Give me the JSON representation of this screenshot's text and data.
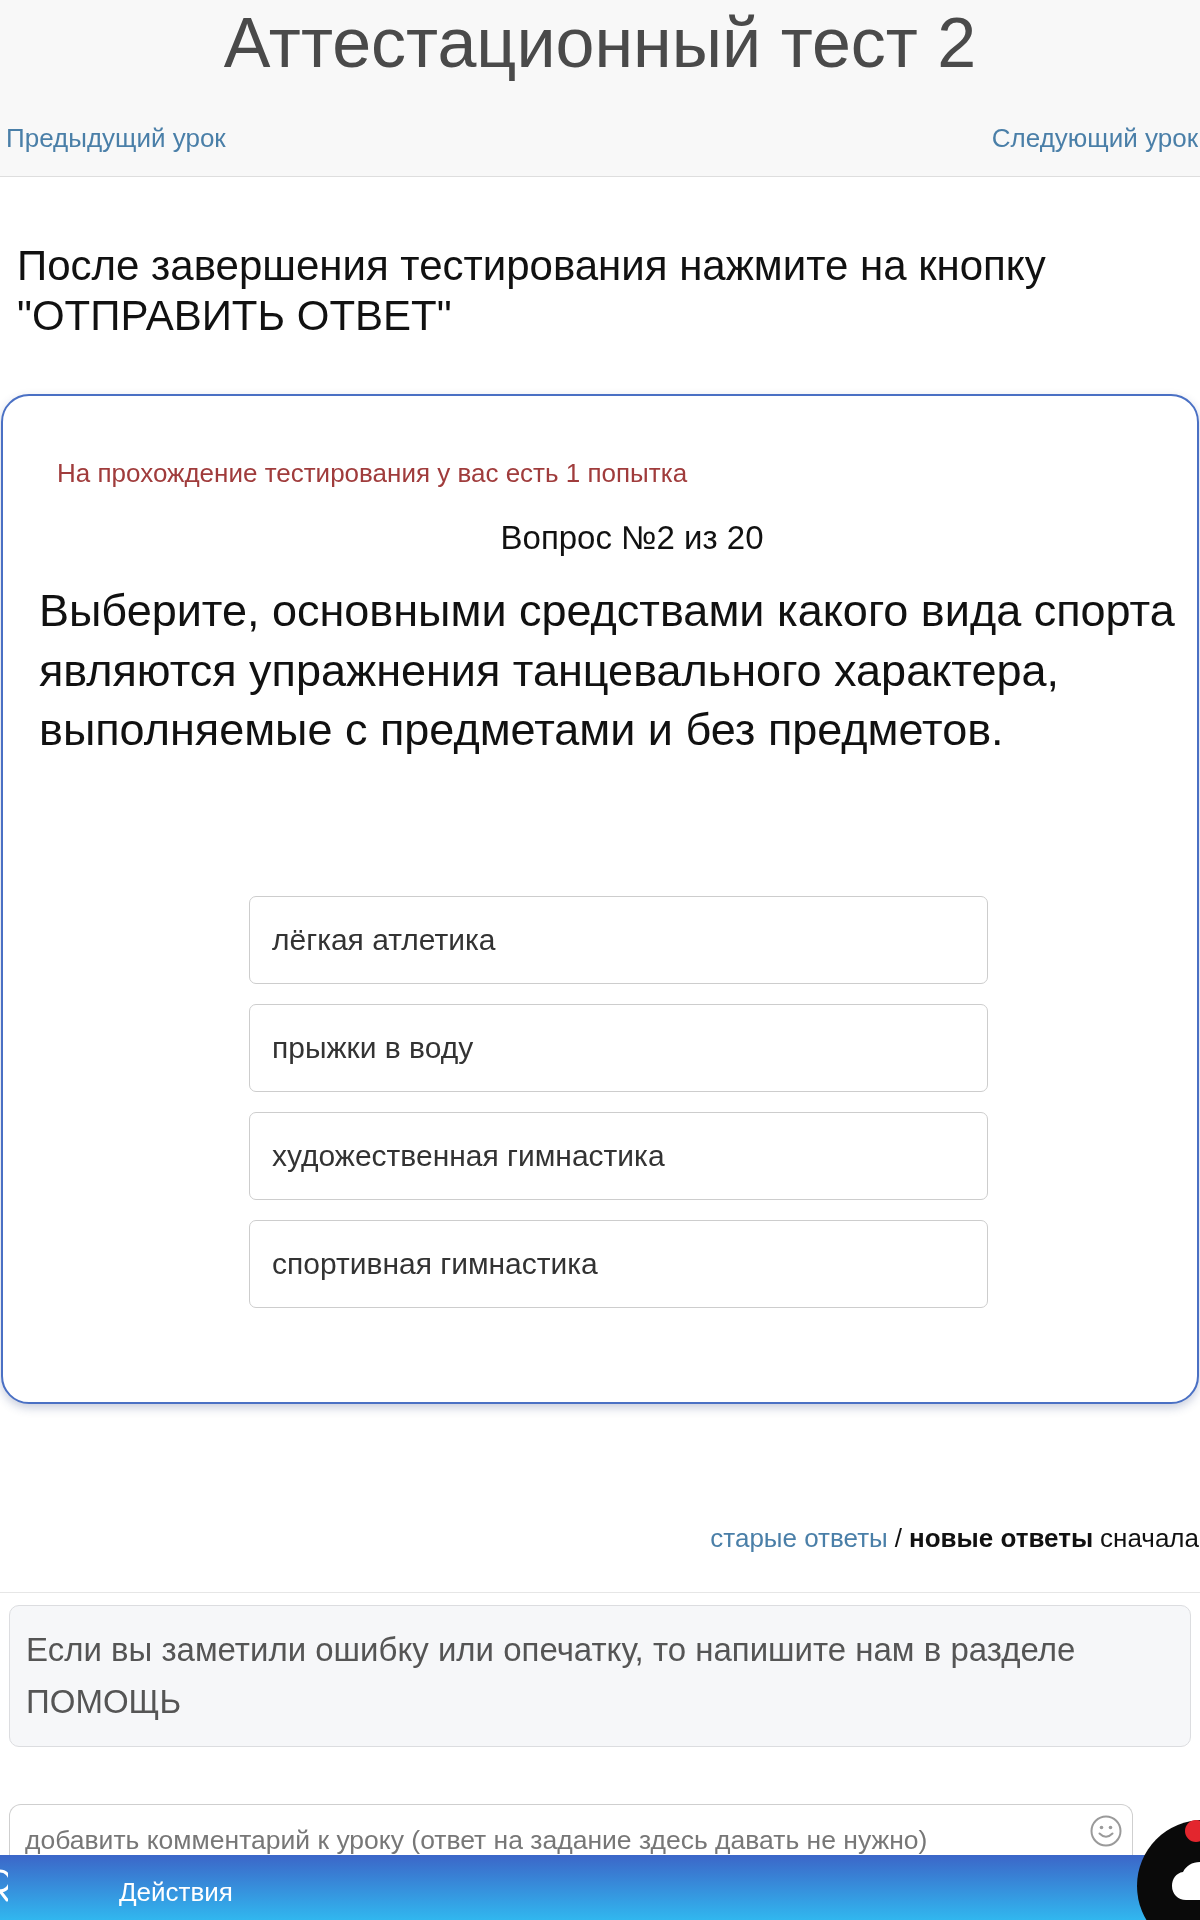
{
  "header": {
    "title": "Аттестационный тест 2",
    "prev_link": "Предыдущий урок",
    "next_link": "Следующий урок"
  },
  "instruction": "После завершения тестирования нажмите на кнопку \"ОТПРАВИТЬ ОТВЕТ\"",
  "quiz": {
    "attempts_note": "На прохождение тестирования у вас есть 1 попытка",
    "counter": "Вопрос №2 из 20",
    "question": "Выберите, основными средствами какого вида спорта являются упражнения танцевального характера, выполняемые с предметами и без предметов.",
    "options": [
      {
        "label": "лёгкая атлетика",
        "selected": false
      },
      {
        "label": "прыжки в воду",
        "selected": false
      },
      {
        "label": "художественная гимнастика",
        "selected": false
      },
      {
        "label": "спортивная гимнастика",
        "selected": false
      }
    ]
  },
  "comments": {
    "sort_options": [
      {
        "label": "старые ответы",
        "selected": false
      },
      {
        "label": "новые ответы",
        "selected": true
      }
    ],
    "separator": "/",
    "suffix": "сначала",
    "help_note": "Если вы заметили ошибку или опечатку, то напишите нам в разделе ПОМОЩЬ",
    "comment_field": {
      "placeholder": "добавить комментарий к уроку (ответ на задание здесь давать не нужно)"
    }
  },
  "bottom_bar": {
    "label": "Действия"
  }
}
